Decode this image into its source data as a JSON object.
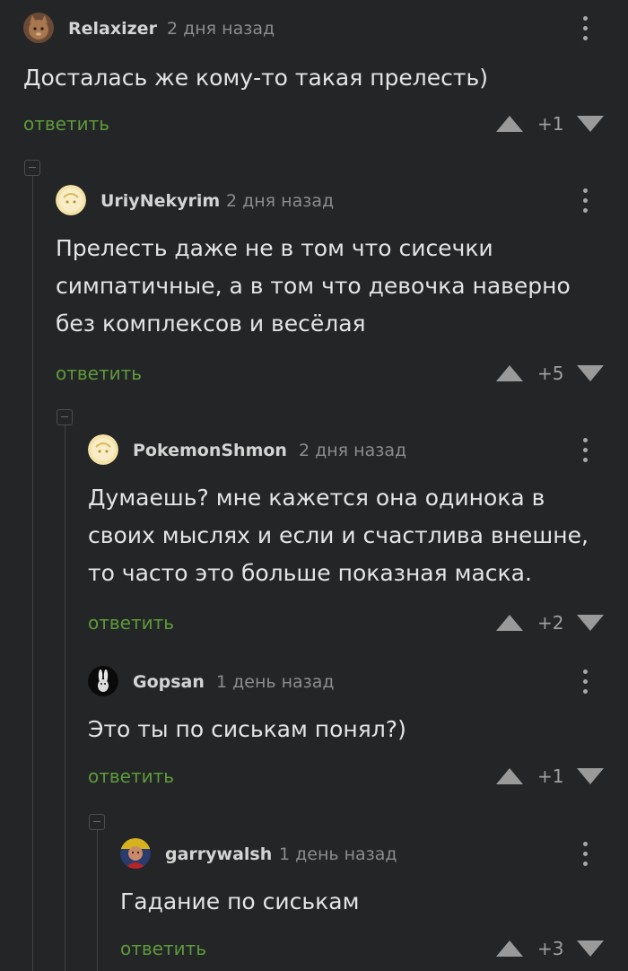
{
  "comments": [
    {
      "username": "Relaxizer",
      "time": "2 дня назад",
      "text": "Досталась же кому-то такая прелесть)",
      "reply_label": "ответить",
      "score": "+1",
      "avatar": "cat-photo-avatar"
    },
    {
      "username": "UriyNekyrim",
      "time": "2 дня назад",
      "text": "Прелесть даже не в том что сисечки симпатичные, а в том что девочка наверно без комплексов и весёлая",
      "reply_label": "ответить",
      "score": "+5",
      "avatar": "default-avatar"
    },
    {
      "username": "PokemonShmon",
      "time": "2 дня назад",
      "text": "Думаешь? мне кажется она одинока в своих мыслях и если и счастлива внешне, то часто это больше показная маска.",
      "reply_label": "ответить",
      "score": "+2",
      "avatar": "default-avatar"
    },
    {
      "username": "Gopsan",
      "time": "1 день назад",
      "text": "Это ты по сиськам  понял?)",
      "reply_label": "ответить",
      "score": "+1",
      "avatar": "rabbit-avatar"
    },
    {
      "username": "garrywalsh",
      "time": "1 день назад",
      "text": "Гадание по сиськам",
      "reply_label": "ответить",
      "score": "+3",
      "avatar": "person-photo-avatar"
    }
  ],
  "colors": {
    "background": "#232527",
    "reply_link": "#5e9a3a",
    "vote_arrow": "#9a9a9a",
    "thread_line": "#3e4145"
  }
}
